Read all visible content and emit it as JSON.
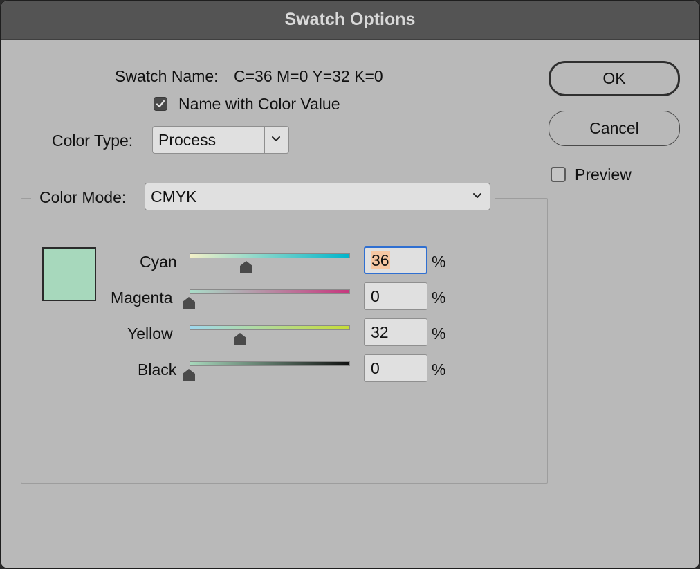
{
  "window": {
    "title": "Swatch Options"
  },
  "swatch_name": {
    "label": "Swatch Name:",
    "value": "C=36 M=0 Y=32 K=0"
  },
  "name_with_color_value": {
    "label": "Name with Color Value",
    "checked": true
  },
  "color_type": {
    "label": "Color Type:",
    "value": "Process"
  },
  "color_mode": {
    "label": "Color Mode:",
    "value": "CMYK"
  },
  "swatch_color": "#a7d8bc",
  "sliders": [
    {
      "label": "Cyan",
      "value": "36",
      "unit": "%"
    },
    {
      "label": "Magenta",
      "value": "0",
      "unit": "%"
    },
    {
      "label": "Yellow",
      "value": "32",
      "unit": "%"
    },
    {
      "label": "Black",
      "value": "0",
      "unit": "%"
    }
  ],
  "buttons": {
    "ok": "OK",
    "cancel": "Cancel"
  },
  "preview": {
    "label": "Preview",
    "checked": false
  },
  "colors": {
    "dialog_bg": "#b9b9b9",
    "titlebar_bg": "#545454",
    "focus_ring": "#2f6fd1",
    "text_selection": "#f7c7a3"
  },
  "icons": {
    "checkbox_checked": "checkmark-icon",
    "dropdown": "chevron-down-icon",
    "slider_thumb": "slider-thumb-icon"
  }
}
